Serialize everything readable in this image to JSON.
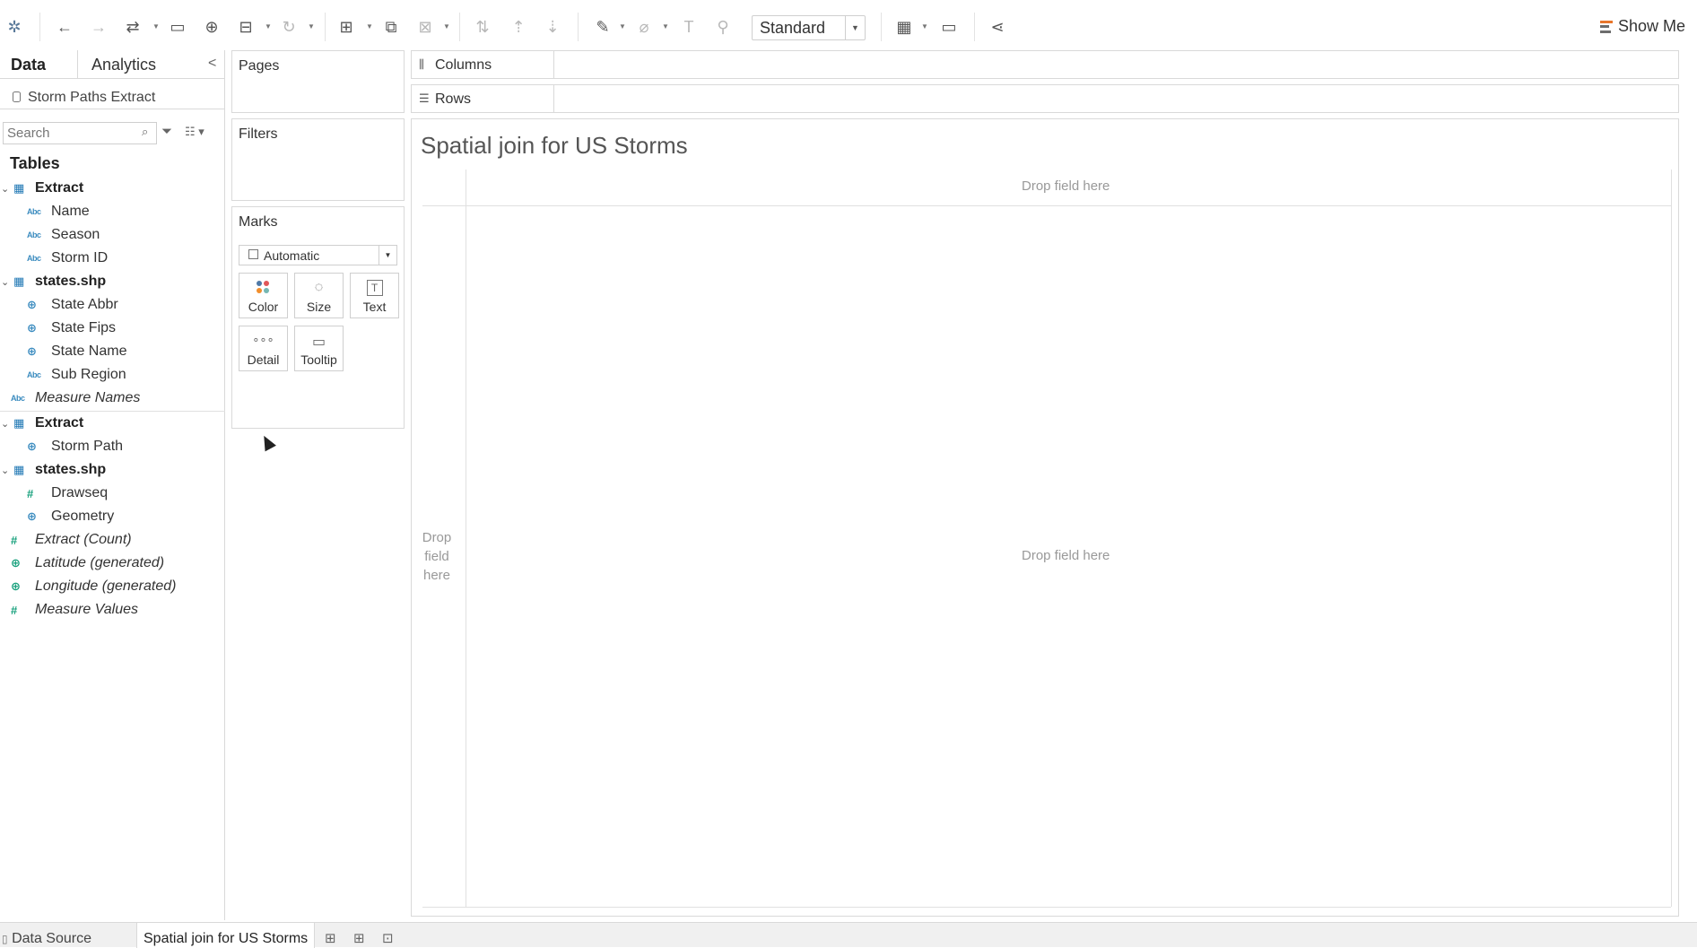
{
  "toolbar": {
    "fit_mode": "Standard",
    "show_me_label": "Show Me",
    "icons": [
      "tableau-logo-icon",
      "undo-icon",
      "redo-icon",
      "replay-icon",
      "save-icon",
      "new-datasource-icon",
      "pause-updates-icon",
      "refresh-icon",
      "new-worksheet-icon",
      "duplicate-sheet-icon",
      "clear-sheet-icon",
      "swap-icon",
      "sort-ascending-icon",
      "sort-descending-icon",
      "highlight-icon",
      "group-icon",
      "label-icon",
      "pin-icon",
      "cards-icon",
      "presentation-icon",
      "share-icon"
    ]
  },
  "left_pane": {
    "tabs": {
      "data": "Data",
      "analytics": "Analytics"
    },
    "datasource": "Storm Paths Extract",
    "search_placeholder": "Search",
    "tables_heading": "Tables",
    "fields": [
      {
        "label": "Extract",
        "kind": "table"
      },
      {
        "label": "Name",
        "kind": "dimension",
        "icon": "Abc"
      },
      {
        "label": "Season",
        "kind": "dimension",
        "icon": "Abc"
      },
      {
        "label": "Storm ID",
        "kind": "dimension",
        "icon": "Abc"
      },
      {
        "label": "states.shp",
        "kind": "table"
      },
      {
        "label": "State Abbr",
        "kind": "geo"
      },
      {
        "label": "State Fips",
        "kind": "geo"
      },
      {
        "label": "State Name",
        "kind": "geo"
      },
      {
        "label": "Sub Region",
        "kind": "dimension",
        "icon": "Abc"
      },
      {
        "label": "Measure Names",
        "kind": "dimension-italic",
        "icon": "Abc"
      },
      {
        "label": "Extract",
        "kind": "table"
      },
      {
        "label": "Storm Path",
        "kind": "geo"
      },
      {
        "label": "states.shp",
        "kind": "table"
      },
      {
        "label": "Drawseq",
        "kind": "measure",
        "icon": "#"
      },
      {
        "label": "Geometry",
        "kind": "geo"
      },
      {
        "label": "Extract (Count)",
        "kind": "measure-italic",
        "icon": "#"
      },
      {
        "label": "Latitude (generated)",
        "kind": "geo-measure-italic"
      },
      {
        "label": "Longitude (generated)",
        "kind": "geo-measure-italic"
      },
      {
        "label": "Measure Values",
        "kind": "measure-italic",
        "icon": "#"
      }
    ]
  },
  "cards": {
    "pages": "Pages",
    "filters": "Filters",
    "marks": "Marks",
    "mark_type": "Automatic",
    "mark_buttons": {
      "color": "Color",
      "size": "Size",
      "text": "Text",
      "detail": "Detail",
      "tooltip": "Tooltip"
    },
    "text_glyph": "T"
  },
  "shelves": {
    "columns": "Columns",
    "rows": "Rows"
  },
  "view": {
    "title": "Spatial join for US Storms",
    "drop_columns": "Drop field here",
    "drop_rows": "Drop field here",
    "drop_center": "Drop field here"
  },
  "bottom_tabs": {
    "data_source": "Data Source",
    "sheet": "Spatial join for US Storms"
  },
  "colors": {
    "accent": "#e8762b",
    "dimension": "#3a8bbf",
    "measure": "#17a07c"
  }
}
